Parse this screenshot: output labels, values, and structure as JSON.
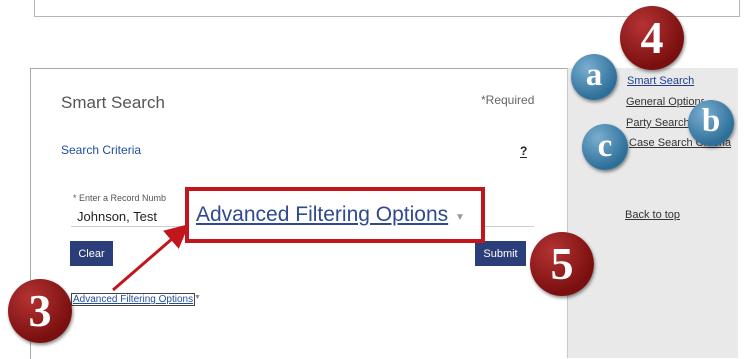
{
  "smart_search": {
    "title": "Smart Search",
    "required_note": "*Required",
    "section_title": "Search Criteria",
    "help_glyph": "?",
    "record_field": {
      "label": "* Enter a Record Numb",
      "value": "Johnson, Test"
    },
    "clear_label": "Clear",
    "submit_label": "Submit",
    "advanced_link": "Advanced Filtering Options",
    "caret_icon": "caret-down-icon"
  },
  "zoom_callout": {
    "text": "Advanced Filtering Options",
    "border_color": "#c0161c"
  },
  "side_nav": {
    "links": [
      "Smart Search",
      "General Options",
      "Party Search",
      "Case Search Criteria"
    ],
    "back_to_top": "Back to top"
  },
  "callouts": {
    "red_markers": [
      "4",
      "5",
      "3"
    ],
    "blue_markers": [
      "a",
      "b",
      "c"
    ],
    "red_color": "#8b1a1a",
    "blue_color": "#3d7fab"
  }
}
